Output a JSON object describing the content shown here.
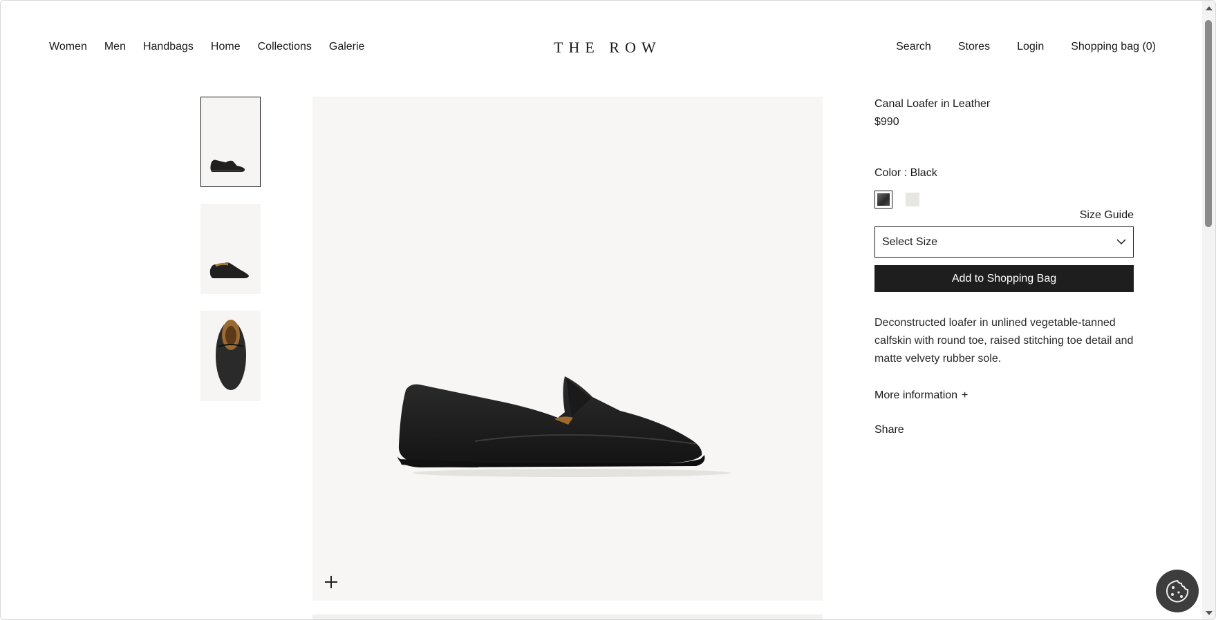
{
  "header": {
    "nav_left": [
      "Women",
      "Men",
      "Handbags",
      "Home",
      "Collections",
      "Galerie"
    ],
    "logo": "THE ROW",
    "nav_right": {
      "search": "Search",
      "stores": "Stores",
      "login": "Login",
      "bag": "Shopping bag (0)"
    }
  },
  "product": {
    "name": "Canal Loafer in Leather",
    "price": "$990",
    "color_label": "Color : Black",
    "swatches": [
      {
        "name": "Black",
        "color": "#2a2a2a",
        "selected": true
      },
      {
        "name": "Cream",
        "color": "#e8e6e1",
        "selected": false
      }
    ],
    "size_guide": "Size Guide",
    "size_placeholder": "Select Size",
    "add_to_bag": "Add to Shopping Bag",
    "description": "Deconstructed loafer in unlined vegetable-tanned calfskin with round toe, raised stitching toe detail and matte velvety rubber sole.",
    "more_info": "More information",
    "more_info_icon": "+",
    "share": "Share"
  },
  "gallery": {
    "thumbnails": [
      "side-view",
      "angle-view",
      "top-view"
    ],
    "active_index": 0
  },
  "colors": {
    "button_bg": "#1e1e1e",
    "image_bg": "#f7f6f4"
  }
}
